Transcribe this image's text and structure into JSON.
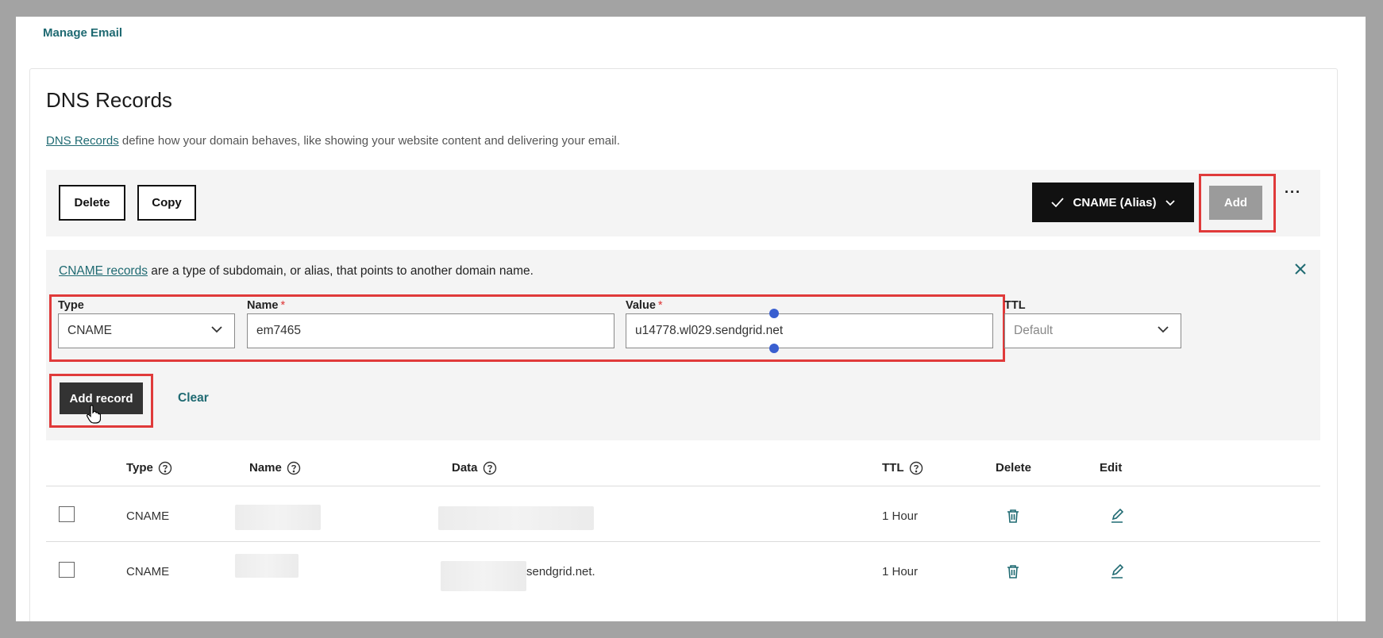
{
  "header": {
    "manage_email": "Manage Email"
  },
  "card": {
    "title": "DNS Records",
    "desc_link": "DNS Records",
    "desc_text": " define how your domain behaves, like showing your website content and delivering your email."
  },
  "toolbar": {
    "delete_label": "Delete",
    "copy_label": "Copy",
    "record_type_selected": "CNAME (Alias)",
    "add_label": "Add",
    "more_label": "···"
  },
  "form": {
    "desc_link": "CNAME records",
    "desc_text": " are a type of subdomain, or alias, that points to another domain name.",
    "type_label": "Type",
    "type_value": "CNAME",
    "name_label": "Name",
    "name_value": "em7465",
    "value_label": "Value",
    "value_value": "u14778.wl029.sendgrid.net",
    "ttl_label": "TTL",
    "ttl_placeholder": "Default",
    "required_mark": "*",
    "add_record_label": "Add record",
    "clear_label": "Clear"
  },
  "table": {
    "headers": {
      "type": "Type",
      "name": "Name",
      "data": "Data",
      "ttl": "TTL",
      "delete": "Delete",
      "edit": "Edit"
    },
    "rows": [
      {
        "type": "CNAME",
        "data_suffix": "",
        "ttl": "1 Hour"
      },
      {
        "type": "CNAME",
        "data_suffix": "sendgrid.net.",
        "ttl": "1 Hour"
      }
    ]
  },
  "colors": {
    "accent": "#1f6a72",
    "highlight": "#e03a3a",
    "dark": "#111111"
  }
}
